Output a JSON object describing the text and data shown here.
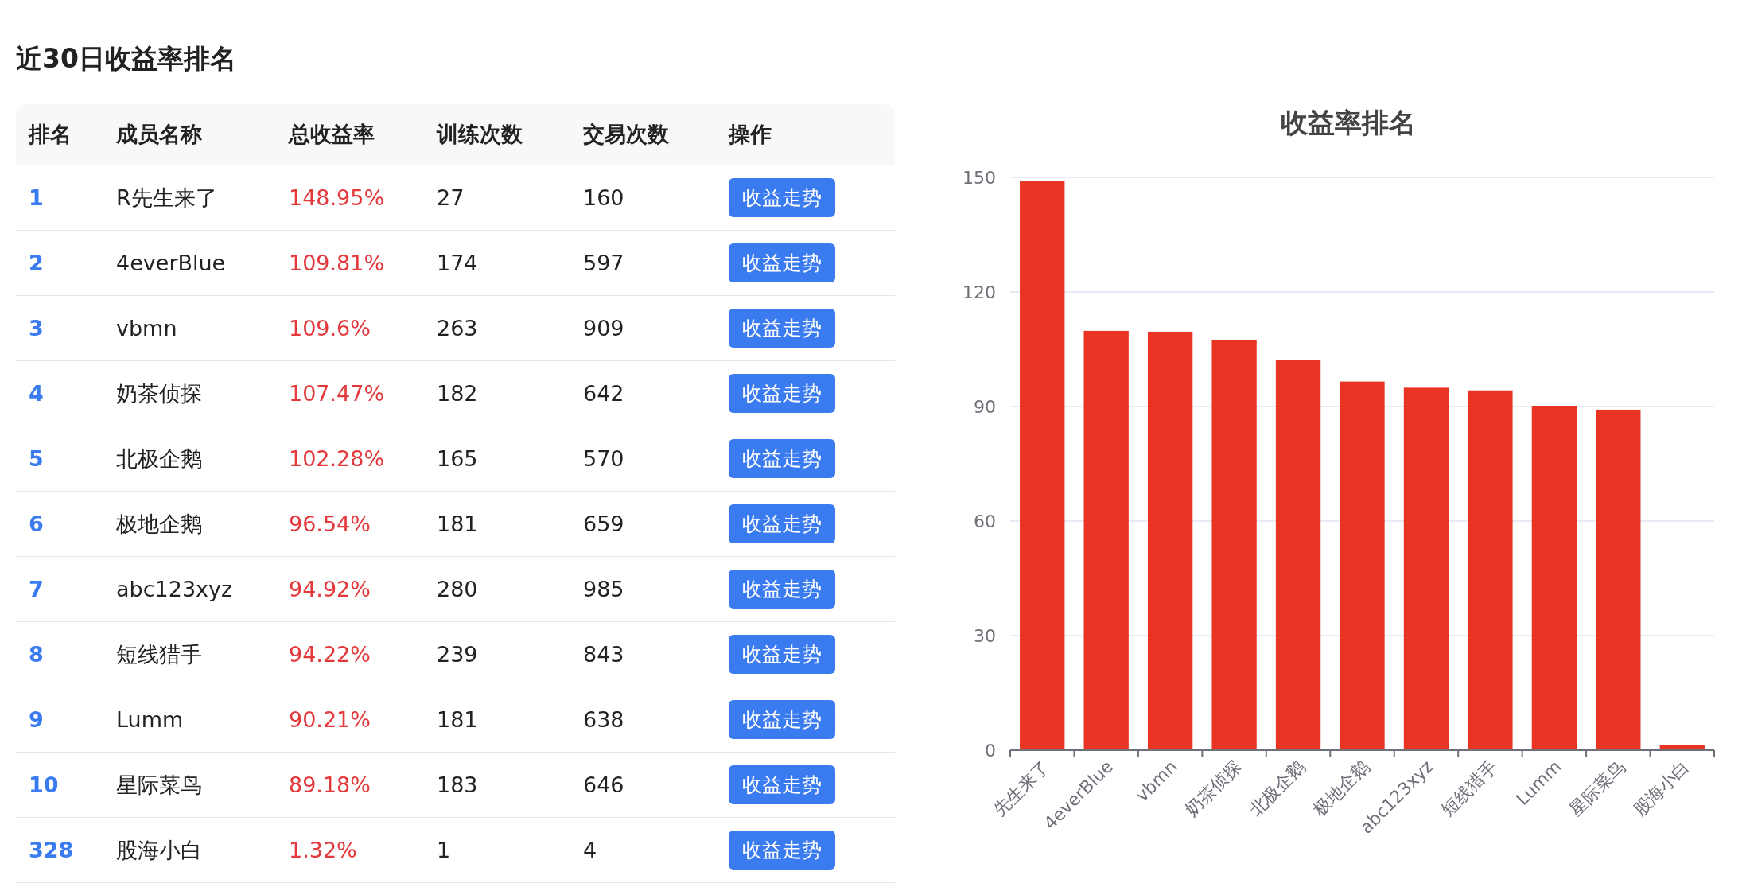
{
  "page_title": "近30日收益率排名",
  "table": {
    "columns": [
      "排名",
      "成员名称",
      "总收益率",
      "训练次数",
      "交易次数",
      "操作"
    ],
    "rows": [
      {
        "rank": "1",
        "name": "R先生来了",
        "return": "148.95%",
        "trainings": "27",
        "trades": "160",
        "action": "收益走势"
      },
      {
        "rank": "2",
        "name": "4everBlue",
        "return": "109.81%",
        "trainings": "174",
        "trades": "597",
        "action": "收益走势"
      },
      {
        "rank": "3",
        "name": "vbmn",
        "return": "109.6%",
        "trainings": "263",
        "trades": "909",
        "action": "收益走势"
      },
      {
        "rank": "4",
        "name": "奶茶侦探",
        "return": "107.47%",
        "trainings": "182",
        "trades": "642",
        "action": "收益走势"
      },
      {
        "rank": "5",
        "name": "北极企鹅",
        "return": "102.28%",
        "trainings": "165",
        "trades": "570",
        "action": "收益走势"
      },
      {
        "rank": "6",
        "name": "极地企鹅",
        "return": "96.54%",
        "trainings": "181",
        "trades": "659",
        "action": "收益走势"
      },
      {
        "rank": "7",
        "name": "abc123xyz",
        "return": "94.92%",
        "trainings": "280",
        "trades": "985",
        "action": "收益走势"
      },
      {
        "rank": "8",
        "name": "短线猎手",
        "return": "94.22%",
        "trainings": "239",
        "trades": "843",
        "action": "收益走势"
      },
      {
        "rank": "9",
        "name": "Lumm",
        "return": "90.21%",
        "trainings": "181",
        "trades": "638",
        "action": "收益走势"
      },
      {
        "rank": "10",
        "name": "星际菜鸟",
        "return": "89.18%",
        "trainings": "183",
        "trades": "646",
        "action": "收益走势"
      },
      {
        "rank": "328",
        "name": "股海小白",
        "return": "1.32%",
        "trainings": "1",
        "trades": "4",
        "action": "收益走势"
      }
    ]
  },
  "chart": {
    "chart_data": {
      "type": "bar",
      "title": "收益率排名",
      "categories": [
        "先生来了",
        "4everBlue",
        "vbmn",
        "奶茶侦探",
        "北极企鹅",
        "极地企鹅",
        "abc123xyz",
        "短线猎手",
        "Lumm",
        "星际菜鸟",
        "股海小白"
      ],
      "grid": true,
      "series": [
        {
          "color": "#e93323",
          "values": [
            148.95,
            109.81,
            109.6,
            107.47,
            102.28,
            96.54,
            94.92,
            94.22,
            90.21,
            89.18,
            1.32
          ]
        }
      ],
      "ylim": [
        0,
        150
      ],
      "yticks": [
        0,
        30,
        60,
        90,
        120,
        150
      ]
    }
  }
}
